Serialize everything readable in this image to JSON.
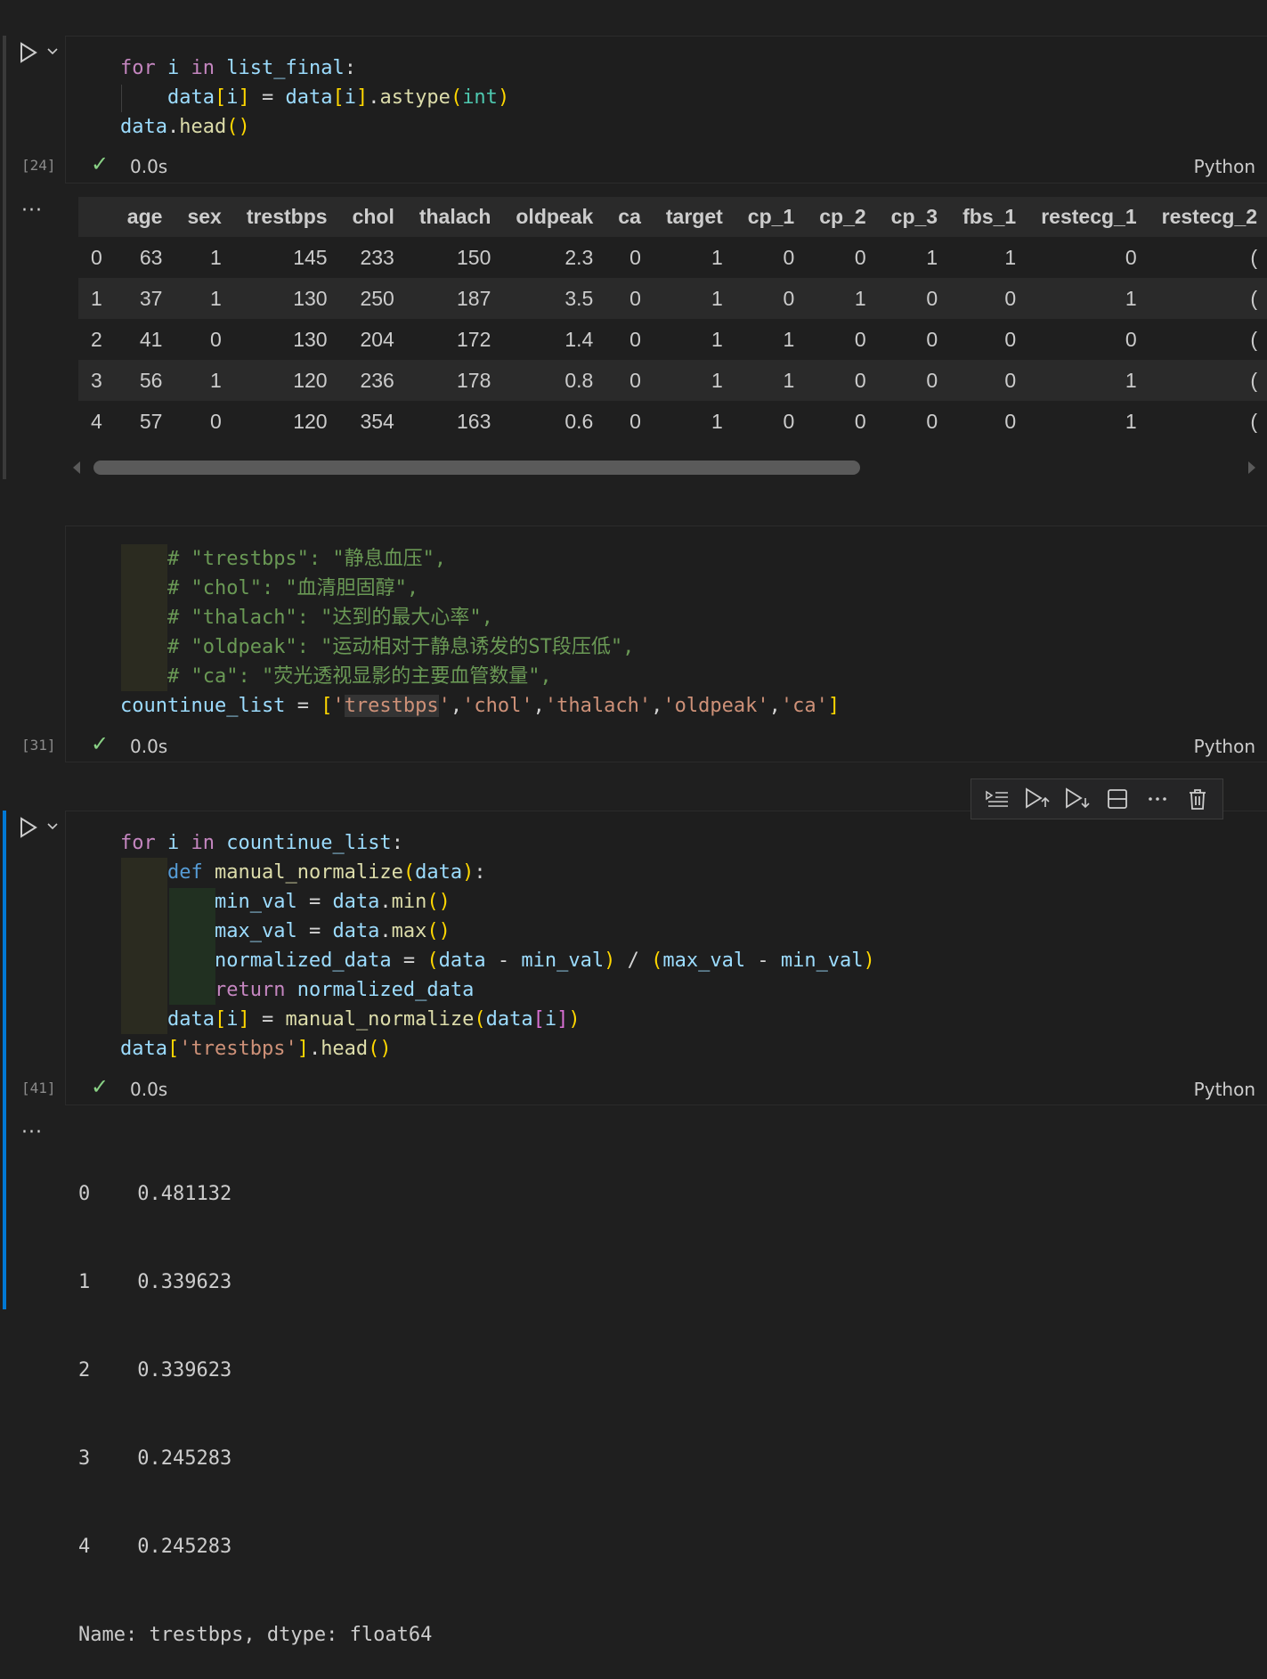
{
  "cells": [
    {
      "exec_count": "[24]",
      "duration": "0.0s",
      "language": "Python",
      "output_table": {
        "columns": [
          "",
          "age",
          "sex",
          "trestbps",
          "chol",
          "thalach",
          "oldpeak",
          "ca",
          "target",
          "cp_1",
          "cp_2",
          "cp_3",
          "fbs_1",
          "restecg_1",
          "restecg_2"
        ],
        "rows": [
          [
            "0",
            "63",
            "1",
            "145",
            "233",
            "150",
            "2.3",
            "0",
            "1",
            "0",
            "0",
            "1",
            "1",
            "0",
            "("
          ],
          [
            "1",
            "37",
            "1",
            "130",
            "250",
            "187",
            "3.5",
            "0",
            "1",
            "0",
            "1",
            "0",
            "0",
            "1",
            "("
          ],
          [
            "2",
            "41",
            "0",
            "130",
            "204",
            "172",
            "1.4",
            "0",
            "1",
            "1",
            "0",
            "0",
            "0",
            "0",
            "("
          ],
          [
            "3",
            "56",
            "1",
            "120",
            "236",
            "178",
            "0.8",
            "0",
            "1",
            "1",
            "0",
            "0",
            "0",
            "1",
            "("
          ],
          [
            "4",
            "57",
            "0",
            "120",
            "354",
            "163",
            "0.6",
            "0",
            "1",
            "0",
            "0",
            "0",
            "0",
            "1",
            "("
          ]
        ]
      }
    },
    {
      "exec_count": "[31]",
      "duration": "0.0s",
      "language": "Python"
    },
    {
      "exec_count": "[41]",
      "duration": "0.0s",
      "language": "Python",
      "output_lines": [
        "0    0.481132",
        "1    0.339623",
        "2    0.339623",
        "3    0.245283",
        "4    0.245283",
        "Name: trestbps, dtype: float64"
      ]
    }
  ],
  "output_more_label": "···",
  "icons": {
    "run": "play-icon",
    "expand": "chevron-down-icon",
    "toolbar": [
      "execute-above-icon",
      "run-above-icon",
      "run-below-icon",
      "split-cell-icon",
      "more-actions-icon",
      "delete-icon"
    ]
  }
}
